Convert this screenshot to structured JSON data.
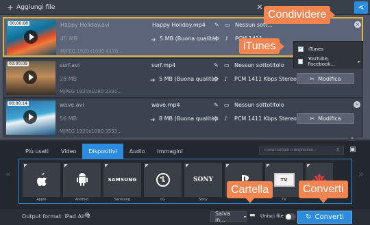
{
  "toolbar": {
    "add_files_label": "Aggiungi file",
    "icons": [
      "plus-icon",
      "magic-wand-icon",
      "share-icon"
    ]
  },
  "files": [
    {
      "duration": "00:00:08",
      "source_name": "Happy Holiday.avi",
      "source_size": "45 MB",
      "source_info": "MJPEG 1920x1080 4178...",
      "output_name": "Happy Holiday.mp4",
      "output_size": "5 MB (Buona qualità)",
      "subtitles": "Nessun sott...",
      "audio": "PCM 1411"
    },
    {
      "duration": "00:00:09",
      "source_name": "surf.avi",
      "source_size": "28 MB",
      "source_info": "MJPEG 1920x1080 2331...",
      "output_name": "surf.mp4",
      "output_size": "5 MB (Buona qualità)",
      "subtitles": "Nessun sottotitolo",
      "audio": "PCM 1411 Kbps Stereo"
    },
    {
      "duration": "00:00:14",
      "source_name": "wave.avi",
      "source_size": "56 MB",
      "source_info": "MJPEG 1920x1080 3555...",
      "output_name": "wave.mp4",
      "output_size": "8 MB (Buona qualità)",
      "subtitles": "Nessun sottotitolo",
      "audio": "PCM 1411 Kbps Stereo"
    }
  ],
  "edit_label": "Modifica",
  "share_menu": {
    "items": [
      {
        "label": "iTunes",
        "checked": true
      },
      {
        "label": "YouTube, Facebook...",
        "checked": false
      }
    ]
  },
  "callouts": {
    "share": "Condividere",
    "itunes": "iTunes",
    "folder": "Cartella",
    "convert": "Converti"
  },
  "format_tabs": [
    "Più usati",
    "Video",
    "Dispositivi",
    "Audio",
    "Immagini"
  ],
  "active_tab": "Dispositivi",
  "search": {
    "placeholder": "Trova formato o dispositivo..."
  },
  "devices": [
    {
      "name": "Apple",
      "icon": "apple-icon"
    },
    {
      "name": "Android",
      "icon": "android-icon"
    },
    {
      "name": "Samsung",
      "icon": "samsung-logo",
      "logo_text": "SAMSUNG"
    },
    {
      "name": "LG",
      "icon": "lg-logo"
    },
    {
      "name": "Sony",
      "icon": "sony-logo",
      "logo_text": "SONY"
    },
    {
      "name": "",
      "icon": "playstation-icon"
    },
    {
      "name": "TV",
      "icon": "tv-icon",
      "logo_text": "TV"
    },
    {
      "name": "",
      "icon": "huawei-icon"
    }
  ],
  "status": {
    "output_format": "Output format: iPad Air 2",
    "save_label": "Salva in...",
    "merge_label": "Unisci file",
    "convert_label": "Converti"
  },
  "colors": {
    "accent": "#2b8ce0",
    "callout": "#f08552",
    "selection_border": "#e8b43c"
  }
}
